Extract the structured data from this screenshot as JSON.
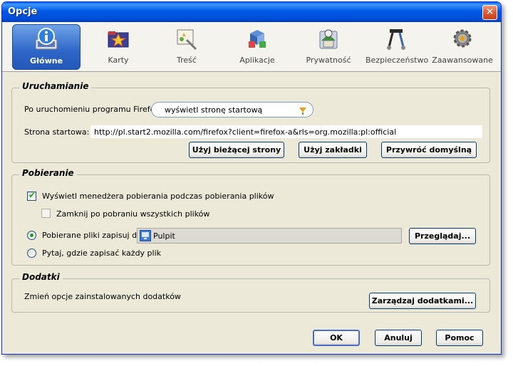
{
  "window": {
    "title": "Opcje",
    "close_label": "✕"
  },
  "tabs": [
    {
      "label": "Główne",
      "icon": "monitor-info-icon",
      "active": true
    },
    {
      "label": "Karty",
      "icon": "tabs-icon",
      "active": false
    },
    {
      "label": "Treść",
      "icon": "content-icon",
      "active": false
    },
    {
      "label": "Aplikacje",
      "icon": "applications-icon",
      "active": false
    },
    {
      "label": "Prywatność",
      "icon": "privacy-icon",
      "active": false
    },
    {
      "label": "Bezpieczeństwo",
      "icon": "security-icon",
      "active": false
    },
    {
      "label": "Zaawansowane",
      "icon": "gear-icon",
      "active": false
    }
  ],
  "startup": {
    "title": "Uruchamianie",
    "on_start_label": "Po uruchomieniu programu Firefox:",
    "on_start_value": "wyświetl stronę startową",
    "homepage_label": "Strona startowa:",
    "homepage_value": "http://pl.start2.mozilla.com/firefox?client=firefox-a&rls=org.mozilla:pl:official",
    "use_current_label": "Użyj bieżącej strony",
    "use_bookmark_label": "Użyj zakładki",
    "restore_default_label": "Przywróć domyślną"
  },
  "downloads": {
    "title": "Pobieranie",
    "show_manager_label": "Wyświetl menedżera pobierania podczas pobierania plików",
    "show_manager_checked": true,
    "close_when_done_label": "Zamknij po pobraniu wszystkich plików",
    "close_when_done_checked": false,
    "save_to_label": "Pobierane pliki zapisuj do:",
    "save_to_selected": true,
    "save_path": "Pulpit",
    "browse_label": "Przeglądaj...",
    "ask_label": "Pytaj, gdzie zapisać każdy plik",
    "ask_selected": false
  },
  "addons": {
    "title": "Dodatki",
    "description": "Zmień opcje zainstalowanych dodatków",
    "manage_label": "Zarządzaj dodatkami..."
  },
  "footer": {
    "ok_label": "OK",
    "cancel_label": "Anuluj",
    "help_label": "Pomoc"
  }
}
